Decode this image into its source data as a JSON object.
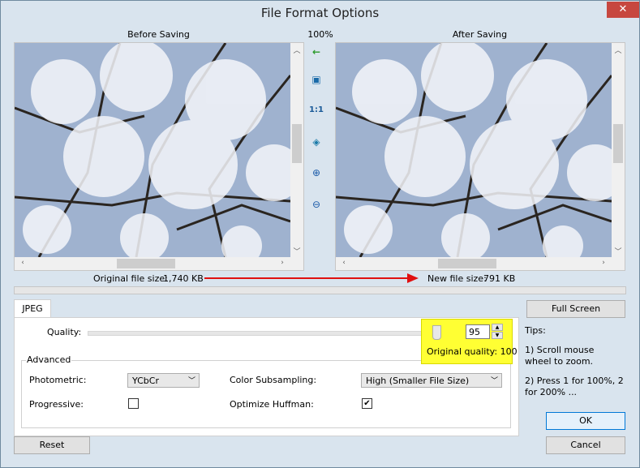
{
  "window": {
    "title": "File Format Options",
    "close_glyph": "✕"
  },
  "preview": {
    "before_label": "Before Saving",
    "after_label": "After Saving",
    "zoom_label": "100%",
    "original_size_label": "Original file size:",
    "original_size_value": "1,740 KB",
    "new_size_label": "New file size:",
    "new_size_value": "791 KB",
    "arrow_color": "#e01010"
  },
  "tools": {
    "sync": "←",
    "fit": "▣",
    "actual": "1:1",
    "fit_window": "◈",
    "zoom_in": "⊕",
    "zoom_out": "⊖"
  },
  "tabs": [
    {
      "label": "JPEG"
    }
  ],
  "jpeg": {
    "quality_label": "Quality:",
    "quality_value": "95",
    "quality_fraction": 0.95,
    "original_quality": "Original quality: 100",
    "highlight_color": "#ffff33",
    "advanced_label": "Advanced",
    "photometric_label": "Photometric:",
    "photometric_value": "YCbCr",
    "subsampling_label": "Color Subsampling:",
    "subsampling_value": "High (Smaller File Size)",
    "progressive_label": "Progressive:",
    "progressive_checked": "",
    "huffman_label": "Optimize Huffman:",
    "huffman_checked": "✔"
  },
  "buttons": {
    "full_screen": "Full Screen",
    "ok": "OK",
    "cancel": "Cancel",
    "reset": "Reset"
  },
  "tips": {
    "title": "Tips:",
    "tip1": "1) Scroll mouse wheel to zoom.",
    "tip2": "2) Press 1 for 100%, 2 for 200% ..."
  }
}
